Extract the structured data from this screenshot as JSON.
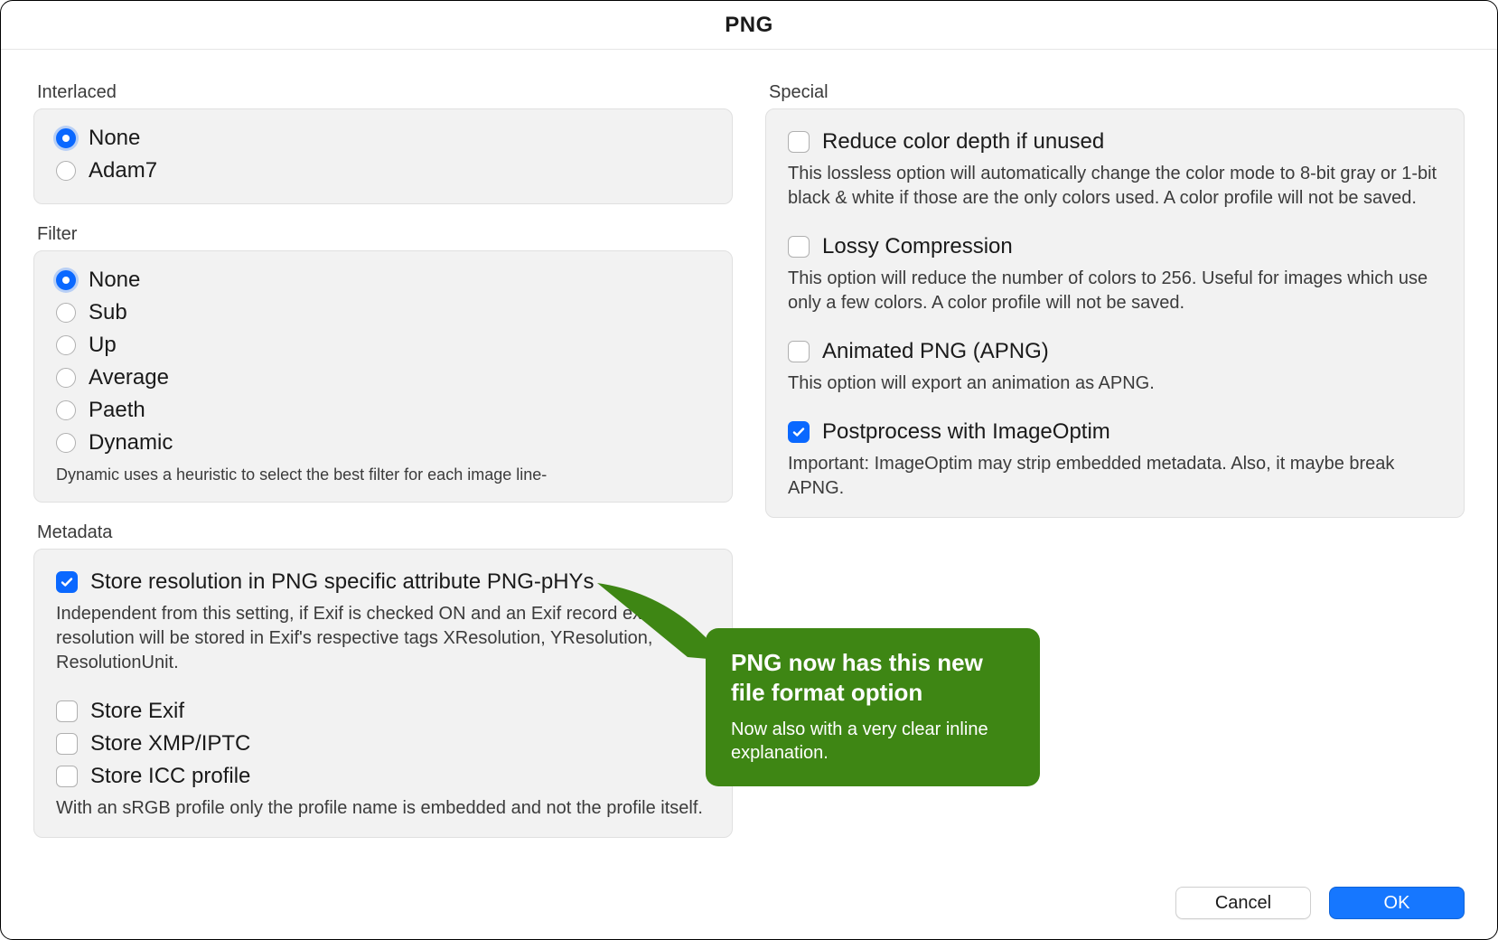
{
  "title": "PNG",
  "interlaced": {
    "title": "Interlaced",
    "options": {
      "none": "None",
      "adam7": "Adam7"
    }
  },
  "filter": {
    "title": "Filter",
    "options": {
      "none": "None",
      "sub": "Sub",
      "up": "Up",
      "average": "Average",
      "paeth": "Paeth",
      "dynamic": "Dynamic"
    },
    "dynamic_desc": "Dynamic uses a heuristic to select the best filter for each image line-"
  },
  "metadata": {
    "title": "Metadata",
    "store_phys": "Store resolution in PNG specific attribute PNG-pHYs",
    "store_phys_desc": "Independent from this setting, if Exif is checked ON and an Exif record exists, resolution will be stored in Exif's respective tags XResolution, YResolution, ResolutionUnit.",
    "store_exif": "Store Exif",
    "store_xmp": "Store XMP/IPTC",
    "store_icc": "Store ICC profile",
    "store_icc_desc": "With an sRGB profile only the profile name is embedded and not the profile itself."
  },
  "special": {
    "title": "Special",
    "reduce": "Reduce color depth if unused",
    "reduce_desc": "This lossless option will automatically change the color mode to 8-bit gray or 1-bit black & white if those are the only colors used. A color profile will not be saved.",
    "lossy": "Lossy Compression",
    "lossy_desc": "This option will reduce the number of colors to 256. Useful for images which use only a few colors. A color profile will not be saved.",
    "apng": "Animated PNG (APNG)",
    "apng_desc": "This option will export an animation as APNG.",
    "postprocess": "Postprocess with ImageOptim",
    "postprocess_desc": "Important: ImageOptim may strip embedded metadata. Also, it maybe break APNG."
  },
  "buttons": {
    "cancel": "Cancel",
    "ok": "OK"
  },
  "callout": {
    "title": "PNG now has this new file format option",
    "body": "Now also with a very clear inline explanation."
  }
}
